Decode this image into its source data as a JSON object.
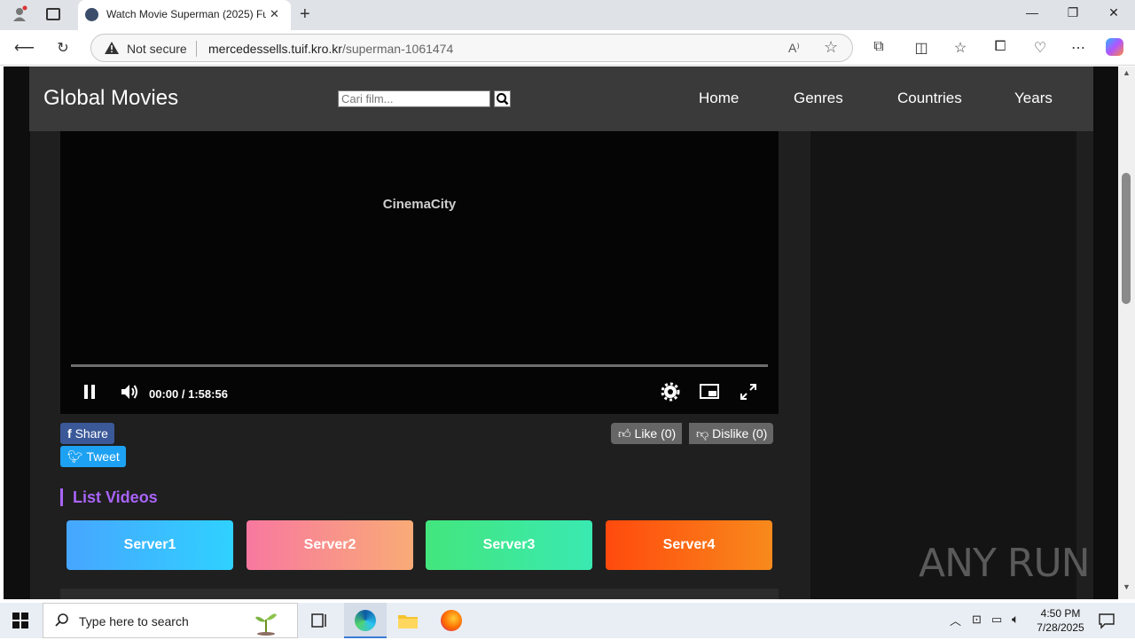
{
  "browser": {
    "tab_title": "Watch Movie Superman (2025) Fu",
    "url_security": "Not secure",
    "url_host": "mercedessells.tuif.kro.kr",
    "url_path": "/superman-1061474"
  },
  "site": {
    "brand": "Global Movies",
    "search_placeholder": "Cari film...",
    "nav": [
      "Home",
      "Genres",
      "Countries",
      "Years"
    ]
  },
  "player": {
    "watermark": "CinemaCity",
    "current_time": "00:00",
    "separator": "/",
    "duration": "1:58:56",
    "progress": 0
  },
  "social": {
    "share": "Share",
    "tweet": "Tweet",
    "like": "Like (0)",
    "dislike": "Dislike (0)"
  },
  "list": {
    "title": "List Videos",
    "servers": [
      "Server1",
      "Server2",
      "Server3",
      "Server4"
    ]
  },
  "watermark": "ANY RUN",
  "taskbar": {
    "search_placeholder": "Type here to search",
    "time": "4:50 PM",
    "date": "7/28/2025"
  },
  "colors": {
    "accent": "#a864f8",
    "facebook": "#3b5998",
    "twitter": "#1da1f2"
  }
}
